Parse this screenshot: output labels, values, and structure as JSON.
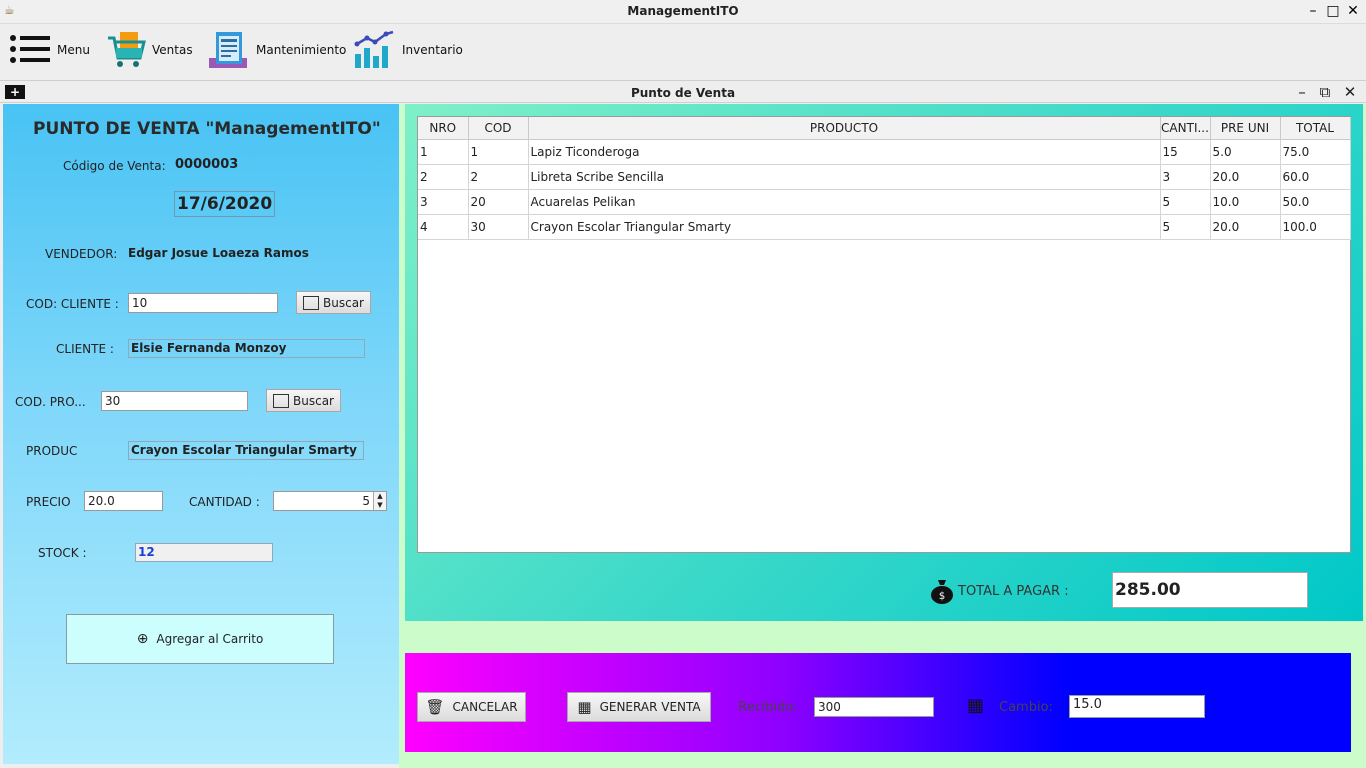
{
  "window": {
    "title": "ManagementITO",
    "controls": {
      "minimize": "–",
      "maximize": "□",
      "close": "✕"
    }
  },
  "menubar": {
    "items": [
      {
        "label": "Menu",
        "icon": "list-icon"
      },
      {
        "label": "Ventas",
        "icon": "cart-icon"
      },
      {
        "label": "Mantenimiento",
        "icon": "receipt-icon"
      },
      {
        "label": "Inventario",
        "icon": "chart-icon"
      }
    ]
  },
  "frame": {
    "title": "Punto de Venta",
    "controls": {
      "minimize": "–",
      "restore": "⧉",
      "close": "✕"
    }
  },
  "form": {
    "heading": "PUNTO DE VENTA \"ManagementITO\"",
    "code_label": "Código de Venta:",
    "code_value": "0000003",
    "date": "17/6/2020",
    "seller_label": "VENDEDOR:",
    "seller_value": "Edgar Josue Loaeza Ramos",
    "client_code_label": "COD: CLIENTE :",
    "client_code_value": "10",
    "search_label": "Buscar",
    "client_label": "CLIENTE :",
    "client_value": "Elsie Fernanda Monzoy",
    "product_code_label": "COD. PRO...",
    "product_code_value": "30",
    "product_label": "PRODUC",
    "product_value": "Crayon Escolar Triangular Smarty",
    "price_label": "PRECIO",
    "price_value": "20.0",
    "qty_label": "CANTIDAD :",
    "qty_value": "5",
    "stock_label": "STOCK :",
    "stock_value": "12",
    "add_label": "Agregar al Carrito"
  },
  "table": {
    "columns": [
      "NRO",
      "COD",
      "PRODUCTO",
      "CANTI...",
      "PRE UNI",
      "TOTAL"
    ],
    "rows": [
      [
        "1",
        "1",
        "Lapiz Ticonderoga",
        "15",
        "5.0",
        "75.0"
      ],
      [
        "2",
        "2",
        "Libreta Scribe Sencilla",
        "3",
        "20.0",
        "60.0"
      ],
      [
        "3",
        "20",
        "Acuarelas Pelikan",
        "5",
        "10.0",
        "50.0"
      ],
      [
        "4",
        "30",
        "Crayon Escolar Triangular Smarty",
        "5",
        "20.0",
        "100.0"
      ]
    ]
  },
  "summary": {
    "total_label": "TOTAL A PAGAR :",
    "total_value": "285.00"
  },
  "actions": {
    "cancel_label": "CANCELAR",
    "generate_label": "GENERAR VENTA",
    "received_label": "Recibido:",
    "received_value": "300",
    "change_label": "Cambio:",
    "change_value": "15.0"
  }
}
